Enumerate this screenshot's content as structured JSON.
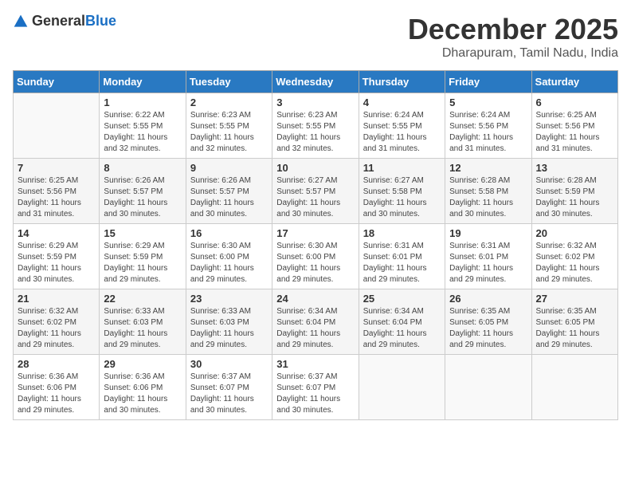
{
  "header": {
    "logo_general": "General",
    "logo_blue": "Blue",
    "month_title": "December 2025",
    "location": "Dharapuram, Tamil Nadu, India"
  },
  "weekdays": [
    "Sunday",
    "Monday",
    "Tuesday",
    "Wednesday",
    "Thursday",
    "Friday",
    "Saturday"
  ],
  "weeks": [
    [
      {
        "day": "",
        "info": ""
      },
      {
        "day": "1",
        "info": "Sunrise: 6:22 AM\nSunset: 5:55 PM\nDaylight: 11 hours\nand 32 minutes."
      },
      {
        "day": "2",
        "info": "Sunrise: 6:23 AM\nSunset: 5:55 PM\nDaylight: 11 hours\nand 32 minutes."
      },
      {
        "day": "3",
        "info": "Sunrise: 6:23 AM\nSunset: 5:55 PM\nDaylight: 11 hours\nand 32 minutes."
      },
      {
        "day": "4",
        "info": "Sunrise: 6:24 AM\nSunset: 5:55 PM\nDaylight: 11 hours\nand 31 minutes."
      },
      {
        "day": "5",
        "info": "Sunrise: 6:24 AM\nSunset: 5:56 PM\nDaylight: 11 hours\nand 31 minutes."
      },
      {
        "day": "6",
        "info": "Sunrise: 6:25 AM\nSunset: 5:56 PM\nDaylight: 11 hours\nand 31 minutes."
      }
    ],
    [
      {
        "day": "7",
        "info": "Sunrise: 6:25 AM\nSunset: 5:56 PM\nDaylight: 11 hours\nand 31 minutes."
      },
      {
        "day": "8",
        "info": "Sunrise: 6:26 AM\nSunset: 5:57 PM\nDaylight: 11 hours\nand 30 minutes."
      },
      {
        "day": "9",
        "info": "Sunrise: 6:26 AM\nSunset: 5:57 PM\nDaylight: 11 hours\nand 30 minutes."
      },
      {
        "day": "10",
        "info": "Sunrise: 6:27 AM\nSunset: 5:57 PM\nDaylight: 11 hours\nand 30 minutes."
      },
      {
        "day": "11",
        "info": "Sunrise: 6:27 AM\nSunset: 5:58 PM\nDaylight: 11 hours\nand 30 minutes."
      },
      {
        "day": "12",
        "info": "Sunrise: 6:28 AM\nSunset: 5:58 PM\nDaylight: 11 hours\nand 30 minutes."
      },
      {
        "day": "13",
        "info": "Sunrise: 6:28 AM\nSunset: 5:59 PM\nDaylight: 11 hours\nand 30 minutes."
      }
    ],
    [
      {
        "day": "14",
        "info": "Sunrise: 6:29 AM\nSunset: 5:59 PM\nDaylight: 11 hours\nand 30 minutes."
      },
      {
        "day": "15",
        "info": "Sunrise: 6:29 AM\nSunset: 5:59 PM\nDaylight: 11 hours\nand 29 minutes."
      },
      {
        "day": "16",
        "info": "Sunrise: 6:30 AM\nSunset: 6:00 PM\nDaylight: 11 hours\nand 29 minutes."
      },
      {
        "day": "17",
        "info": "Sunrise: 6:30 AM\nSunset: 6:00 PM\nDaylight: 11 hours\nand 29 minutes."
      },
      {
        "day": "18",
        "info": "Sunrise: 6:31 AM\nSunset: 6:01 PM\nDaylight: 11 hours\nand 29 minutes."
      },
      {
        "day": "19",
        "info": "Sunrise: 6:31 AM\nSunset: 6:01 PM\nDaylight: 11 hours\nand 29 minutes."
      },
      {
        "day": "20",
        "info": "Sunrise: 6:32 AM\nSunset: 6:02 PM\nDaylight: 11 hours\nand 29 minutes."
      }
    ],
    [
      {
        "day": "21",
        "info": "Sunrise: 6:32 AM\nSunset: 6:02 PM\nDaylight: 11 hours\nand 29 minutes."
      },
      {
        "day": "22",
        "info": "Sunrise: 6:33 AM\nSunset: 6:03 PM\nDaylight: 11 hours\nand 29 minutes."
      },
      {
        "day": "23",
        "info": "Sunrise: 6:33 AM\nSunset: 6:03 PM\nDaylight: 11 hours\nand 29 minutes."
      },
      {
        "day": "24",
        "info": "Sunrise: 6:34 AM\nSunset: 6:04 PM\nDaylight: 11 hours\nand 29 minutes."
      },
      {
        "day": "25",
        "info": "Sunrise: 6:34 AM\nSunset: 6:04 PM\nDaylight: 11 hours\nand 29 minutes."
      },
      {
        "day": "26",
        "info": "Sunrise: 6:35 AM\nSunset: 6:05 PM\nDaylight: 11 hours\nand 29 minutes."
      },
      {
        "day": "27",
        "info": "Sunrise: 6:35 AM\nSunset: 6:05 PM\nDaylight: 11 hours\nand 29 minutes."
      }
    ],
    [
      {
        "day": "28",
        "info": "Sunrise: 6:36 AM\nSunset: 6:06 PM\nDaylight: 11 hours\nand 29 minutes."
      },
      {
        "day": "29",
        "info": "Sunrise: 6:36 AM\nSunset: 6:06 PM\nDaylight: 11 hours\nand 30 minutes."
      },
      {
        "day": "30",
        "info": "Sunrise: 6:37 AM\nSunset: 6:07 PM\nDaylight: 11 hours\nand 30 minutes."
      },
      {
        "day": "31",
        "info": "Sunrise: 6:37 AM\nSunset: 6:07 PM\nDaylight: 11 hours\nand 30 minutes."
      },
      {
        "day": "",
        "info": ""
      },
      {
        "day": "",
        "info": ""
      },
      {
        "day": "",
        "info": ""
      }
    ]
  ]
}
